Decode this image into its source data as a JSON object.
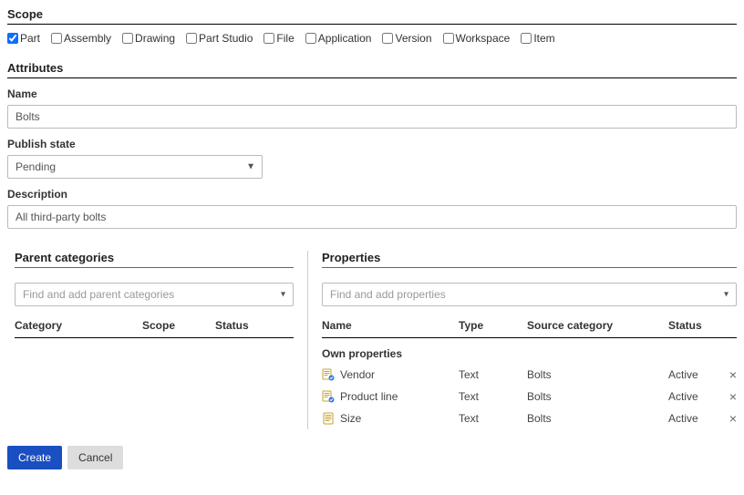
{
  "scope": {
    "header": "Scope",
    "options": [
      {
        "label": "Part",
        "checked": true
      },
      {
        "label": "Assembly",
        "checked": false
      },
      {
        "label": "Drawing",
        "checked": false
      },
      {
        "label": "Part Studio",
        "checked": false
      },
      {
        "label": "File",
        "checked": false
      },
      {
        "label": "Application",
        "checked": false
      },
      {
        "label": "Version",
        "checked": false
      },
      {
        "label": "Workspace",
        "checked": false
      },
      {
        "label": "Item",
        "checked": false
      }
    ]
  },
  "attributes": {
    "header": "Attributes",
    "name_label": "Name",
    "name_value": "Bolts",
    "publish_label": "Publish state",
    "publish_value": "Pending",
    "description_label": "Description",
    "description_value": "All third-party bolts"
  },
  "parent": {
    "header": "Parent categories",
    "placeholder": "Find and add parent categories",
    "columns": {
      "category": "Category",
      "scope": "Scope",
      "status": "Status"
    }
  },
  "properties": {
    "header": "Properties",
    "placeholder": "Find and add properties",
    "columns": {
      "name": "Name",
      "type": "Type",
      "source": "Source category",
      "status": "Status"
    },
    "group_label": "Own properties",
    "rows": [
      {
        "name": "Vendor",
        "type": "Text",
        "source": "Bolts",
        "status": "Active",
        "icon": "linked"
      },
      {
        "name": "Product line",
        "type": "Text",
        "source": "Bolts",
        "status": "Active",
        "icon": "linked"
      },
      {
        "name": "Size",
        "type": "Text",
        "source": "Bolts",
        "status": "Active",
        "icon": "plain"
      }
    ]
  },
  "buttons": {
    "create": "Create",
    "cancel": "Cancel"
  }
}
